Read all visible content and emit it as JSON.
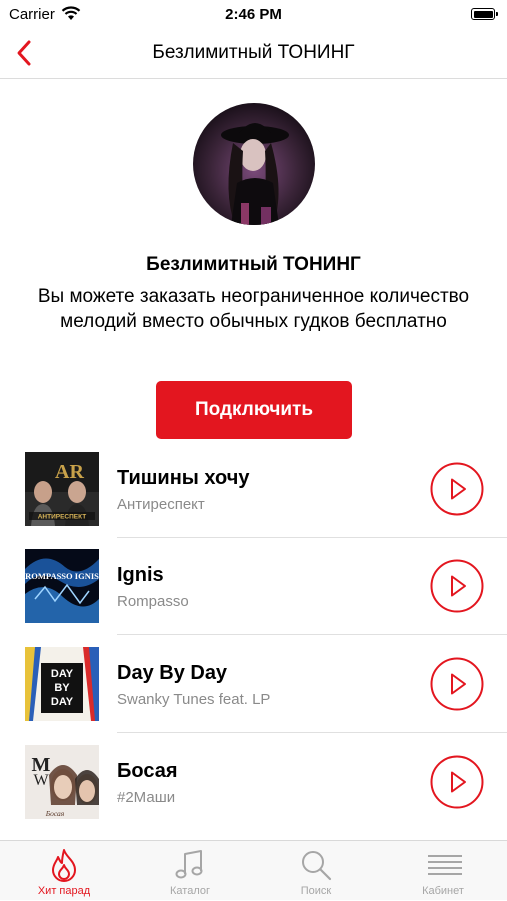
{
  "status_bar": {
    "carrier": "Carrier",
    "time": "2:46 PM"
  },
  "nav": {
    "title": "Безлимитный ТОНИНГ"
  },
  "hero": {
    "title": "Безлимитный ТОНИНГ",
    "description": "Вы можете заказать неограниченное количество мелодий вместо обычных гудков бесплатно",
    "connect_label": "Подключить"
  },
  "tracks": [
    {
      "title": "Тишины хочу",
      "artist": "Антиреспект",
      "cover_text": "АНТИРЕСПЕКТ"
    },
    {
      "title": "Ignis",
      "artist": "Rompasso",
      "cover_text": "ROMPASSO IGNIS"
    },
    {
      "title": "Day By Day",
      "artist": "Swanky Tunes feat. LP",
      "cover_text": "DAY BY DAY"
    },
    {
      "title": "Босая",
      "artist": "#2Маши",
      "cover_text": "Босая"
    }
  ],
  "tabs": [
    {
      "label": "Хит парад",
      "icon": "flame-icon",
      "active": true
    },
    {
      "label": "Каталог",
      "icon": "music-note-icon",
      "active": false
    },
    {
      "label": "Поиск",
      "icon": "search-icon",
      "active": false
    },
    {
      "label": "Кабинет",
      "icon": "menu-lines-icon",
      "active": false
    }
  ],
  "colors": {
    "accent": "#e3161f",
    "inactive": "#a6a6a6",
    "secondary_text": "#8a8a8a"
  }
}
